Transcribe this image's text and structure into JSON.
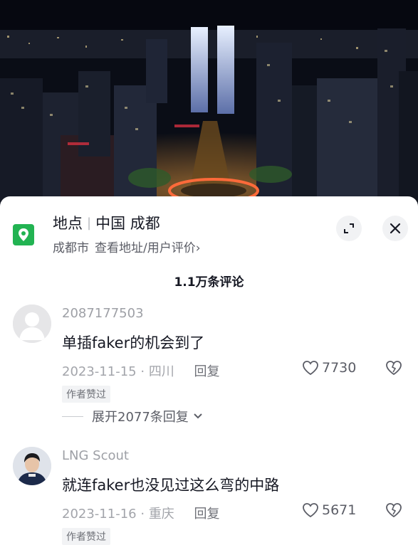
{
  "location": {
    "label": "地点",
    "place": "中国 成都",
    "city": "成都市",
    "link_text": "查看地址/用户评价",
    "link_chevron": "›",
    "icon": "location-pin-icon"
  },
  "header_buttons": {
    "expand_icon": "expand-icon",
    "close_icon": "close-icon"
  },
  "comments_count": "1.1万条评论",
  "comments": [
    {
      "user": "2087177503",
      "text": "单插faker的机会到了",
      "date": "2023-11-15",
      "region": "四川",
      "reply": "回复",
      "likes": "7730",
      "badge": "作者赞过",
      "expand_replies": "展开2077条回复"
    },
    {
      "user": "LNG Scout",
      "text": "就连faker也没见过这么弯的中路",
      "date": "2023-11-16",
      "region": "重庆",
      "reply": "回复",
      "likes": "5671",
      "badge": "作者赞过"
    }
  ],
  "colors": {
    "accent_green": "#22b352",
    "text": "#161823",
    "muted": "#a3a5ab"
  }
}
